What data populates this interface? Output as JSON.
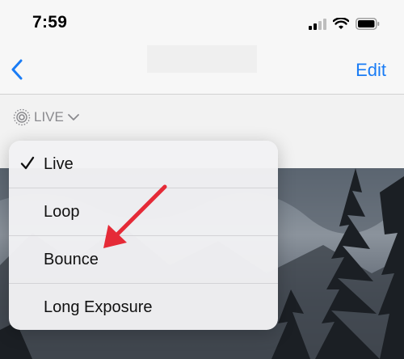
{
  "status_bar": {
    "time": "7:59"
  },
  "nav": {
    "edit_label": "Edit"
  },
  "live_toggle": {
    "label": "LIVE"
  },
  "menu": {
    "selected_index": 0,
    "items": [
      {
        "label": "Live"
      },
      {
        "label": "Loop"
      },
      {
        "label": "Bounce"
      },
      {
        "label": "Long Exposure"
      }
    ]
  },
  "colors": {
    "accent": "#1a7cf5",
    "annotation_arrow": "#e52a37"
  }
}
